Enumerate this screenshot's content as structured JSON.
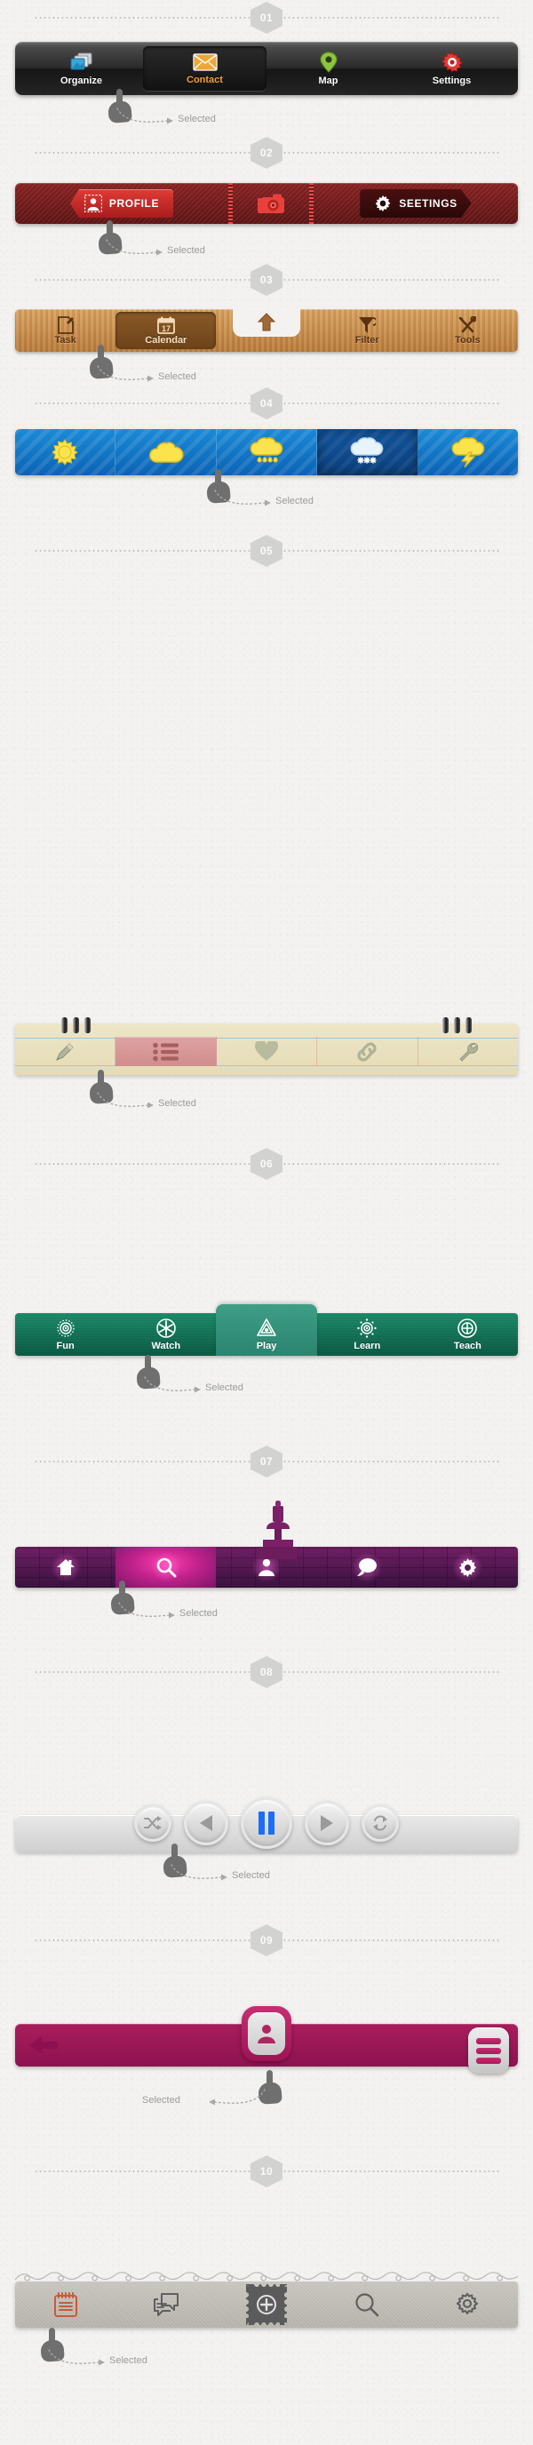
{
  "page": {
    "annotation_label": "Selected",
    "sections": [
      {
        "number": "01",
        "style": "dark-glossy"
      },
      {
        "number": "02",
        "style": "red-metal"
      },
      {
        "number": "03",
        "style": "wood"
      },
      {
        "number": "04",
        "style": "weather-blue"
      },
      {
        "number": "05",
        "style": "notepaper"
      },
      {
        "number": "06",
        "style": "green-fabric"
      },
      {
        "number": "07",
        "style": "purple-brick"
      },
      {
        "number": "08",
        "style": "media-player"
      },
      {
        "number": "09",
        "style": "magenta"
      },
      {
        "number": "10",
        "style": "grey-ornament"
      }
    ]
  },
  "bar01": {
    "items": [
      {
        "label": "Organize",
        "icon": "photos-stack-icon",
        "selected": false
      },
      {
        "label": "Contact",
        "icon": "envelope-icon",
        "selected": true
      },
      {
        "label": "Map",
        "icon": "map-pin-icon",
        "selected": false
      },
      {
        "label": "Settings",
        "icon": "gear-icon",
        "selected": false
      }
    ],
    "accent": "#f0a030"
  },
  "bar02": {
    "items": [
      {
        "label": "PROFILE",
        "icon": "profile-photo-icon",
        "selected": true
      },
      {
        "label": "",
        "icon": "camera-icon",
        "selected": false
      },
      {
        "label": "SEETINGS",
        "icon": "gear-icon",
        "selected": false
      }
    ],
    "accent": "#e03b35"
  },
  "bar03": {
    "items": [
      {
        "label": "Task",
        "icon": "task-note-icon",
        "selected": false
      },
      {
        "label": "Calendar",
        "icon": "calendar-icon",
        "calendar_day": "17",
        "selected": true
      },
      {
        "label": "",
        "icon": "up-arrow-icon",
        "selected": false
      },
      {
        "label": "Filter",
        "icon": "funnel-icon",
        "selected": false
      },
      {
        "label": "Tools",
        "icon": "tools-icon",
        "selected": false
      }
    ],
    "accent": "#b87c3d"
  },
  "bar04": {
    "items": [
      {
        "label": "",
        "icon": "sun-icon",
        "selected": false
      },
      {
        "label": "",
        "icon": "cloud-icon",
        "selected": false
      },
      {
        "label": "",
        "icon": "rain-cloud-icon",
        "selected": false
      },
      {
        "label": "",
        "icon": "snow-cloud-icon",
        "selected": true
      },
      {
        "label": "",
        "icon": "thunderstorm-icon",
        "selected": false
      }
    ],
    "accent": "#1b8ad6"
  },
  "bar05": {
    "items": [
      {
        "label": "",
        "icon": "pencil-icon",
        "selected": false
      },
      {
        "label": "",
        "icon": "list-icon",
        "selected": true
      },
      {
        "label": "",
        "icon": "heart-icon",
        "selected": false
      },
      {
        "label": "",
        "icon": "link-icon",
        "selected": false
      },
      {
        "label": "",
        "icon": "wrench-icon",
        "selected": false
      }
    ],
    "accent": "#d08d8d"
  },
  "bar06": {
    "items": [
      {
        "label": "Fun",
        "icon": "gear-circle-icon",
        "selected": false
      },
      {
        "label": "Watch",
        "icon": "asterisk-circle-icon",
        "selected": false
      },
      {
        "label": "Play",
        "icon": "triangle-play-icon",
        "selected": true
      },
      {
        "label": "Learn",
        "icon": "sun-target-icon",
        "selected": false
      },
      {
        "label": "Teach",
        "icon": "crosshair-icon",
        "selected": false
      }
    ],
    "accent": "#2b8470"
  },
  "bar07": {
    "items": [
      {
        "label": "",
        "icon": "home-icon",
        "selected": false
      },
      {
        "label": "",
        "icon": "search-icon",
        "selected": true
      },
      {
        "label": "",
        "icon": "person-icon",
        "selected": false
      },
      {
        "label": "",
        "icon": "chat-bubble-icon",
        "selected": false
      },
      {
        "label": "",
        "icon": "gear-icon",
        "selected": false
      }
    ],
    "accent": "#ff3fb0"
  },
  "bar08": {
    "items": [
      {
        "label": "",
        "icon": "shuffle-icon",
        "selected": false
      },
      {
        "label": "",
        "icon": "previous-icon",
        "selected": false
      },
      {
        "label": "",
        "icon": "pause-icon",
        "selected": true
      },
      {
        "label": "",
        "icon": "play-icon",
        "selected": false
      },
      {
        "label": "",
        "icon": "repeat-icon",
        "selected": false
      }
    ],
    "accent": "#1b6ef5"
  },
  "bar09": {
    "items": [
      {
        "label": "",
        "icon": "back-arrow-icon",
        "selected": false
      },
      {
        "label": "",
        "icon": "avatar-icon",
        "selected": false
      },
      {
        "label": "",
        "icon": "menu-list-icon",
        "selected": true
      }
    ],
    "accent": "#a81d5c"
  },
  "bar10": {
    "items": [
      {
        "label": "",
        "icon": "notepad-icon",
        "selected": true
      },
      {
        "label": "",
        "icon": "chat-bubbles-icon",
        "selected": false
      },
      {
        "label": "",
        "icon": "stamp-plus-icon",
        "selected": false
      },
      {
        "label": "",
        "icon": "search-icon",
        "selected": false
      },
      {
        "label": "",
        "icon": "gear-icon",
        "selected": false
      }
    ],
    "accent": "#c75b3a"
  }
}
